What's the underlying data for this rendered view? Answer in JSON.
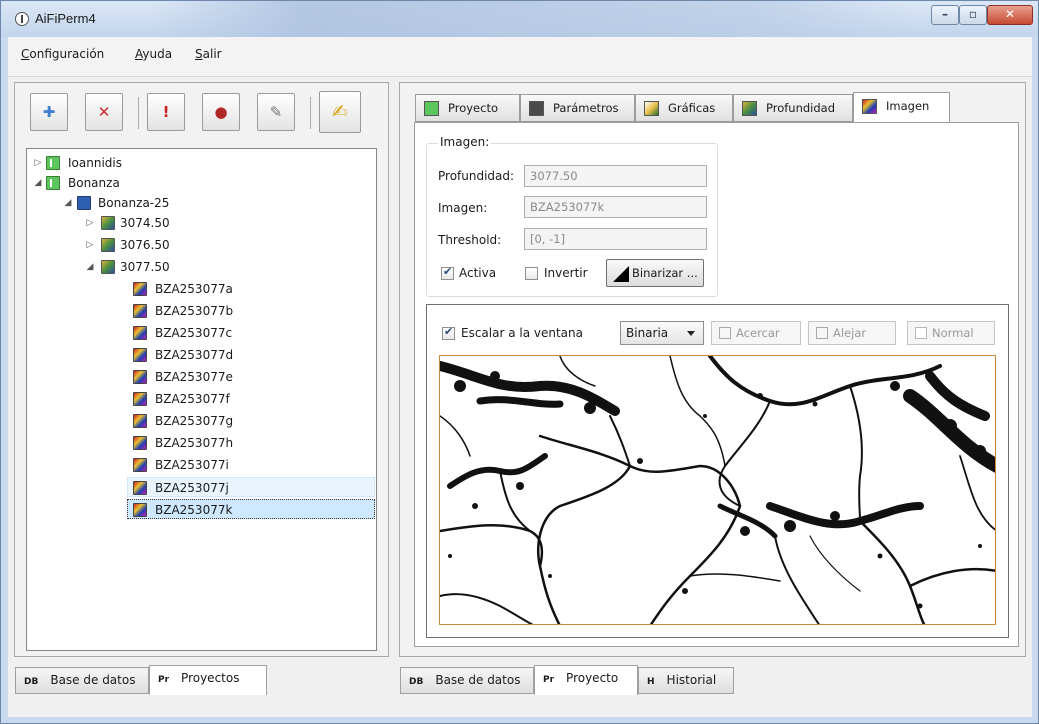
{
  "window": {
    "title": "AiFiPerm4",
    "controls": {
      "minimize": "–",
      "maximize": "▫",
      "close": "✕"
    }
  },
  "menu": {
    "items": [
      "Configuración",
      "Ayuda",
      "Salir"
    ]
  },
  "toolbar": {
    "buttons": [
      {
        "name": "add",
        "glyph": "✚",
        "color": "#3f7fd1"
      },
      {
        "name": "delete",
        "glyph": "✕",
        "color": "#c62b2b"
      },
      {
        "name": "alert",
        "glyph": "!",
        "color": "#cc1f1f"
      },
      {
        "name": "pore",
        "glyph": "●",
        "color": "#b02828"
      },
      {
        "name": "wand",
        "glyph": "✎",
        "color": "#777777"
      },
      {
        "name": "calculate",
        "glyph": "✍",
        "color": "#d6a21a"
      }
    ]
  },
  "tree": {
    "nodes": [
      {
        "label": "Ioannidis",
        "icon": "project",
        "expander": "▷"
      },
      {
        "label": "Bonanza",
        "icon": "project",
        "expander": "◢"
      },
      {
        "label": "Bonanza-25",
        "icon": "well",
        "expander": "◢"
      },
      {
        "label": "3074.50",
        "icon": "depth",
        "expander": "▷"
      },
      {
        "label": "3076.50",
        "icon": "depth",
        "expander": "▷"
      },
      {
        "label": "3077.50",
        "icon": "depth",
        "expander": "◢"
      },
      {
        "label": "BZA253077a",
        "icon": "image"
      },
      {
        "label": "BZA253077b",
        "icon": "image"
      },
      {
        "label": "BZA253077c",
        "icon": "image"
      },
      {
        "label": "BZA253077d",
        "icon": "image"
      },
      {
        "label": "BZA253077e",
        "icon": "image"
      },
      {
        "label": "BZA253077f",
        "icon": "image"
      },
      {
        "label": "BZA253077g",
        "icon": "image"
      },
      {
        "label": "BZA253077h",
        "icon": "image"
      },
      {
        "label": "BZA253077i",
        "icon": "image"
      },
      {
        "label": "BZA253077j",
        "icon": "image"
      },
      {
        "label": "BZA253077k",
        "icon": "image"
      }
    ],
    "selected": "BZA253077k"
  },
  "left_bottom_tabs": {
    "db_code": "DB",
    "db_label": "Base de datos",
    "pr_code": "Pr",
    "pr_label": "Proyectos"
  },
  "right_bottom_tabs": {
    "db_code": "DB",
    "db_label": "Base de datos",
    "pr_code": "Pr",
    "pr_label": "Proyecto",
    "h_code": "H",
    "h_label": "Historial"
  },
  "tabs": [
    "Proyecto",
    "Parámetros",
    "Gráficas",
    "Profundidad",
    "Imagen"
  ],
  "active_tab": "Imagen",
  "imagen_group": {
    "legend": "Imagen:",
    "profundidad_label": "Profundidad:",
    "profundidad_value": "3077.50",
    "imagen_label": "Imagen:",
    "imagen_value": "BZA253077k",
    "threshold_label": "Threshold:",
    "threshold_value": "[0, -1]",
    "activa_label": "Activa",
    "activa_checked": true,
    "invertir_label": "Invertir",
    "invertir_checked": false,
    "binarizar_label": "Binarizar ..."
  },
  "viewer": {
    "escalar_label": "Escalar a la ventana",
    "escalar_checked": true,
    "mode_value": "Binaria",
    "acercar_label": "Acercar",
    "alejar_label": "Alejar",
    "normal_label": "Normal"
  },
  "colors": {
    "accent": "#c98a3a",
    "selection": "#cde8ff"
  }
}
